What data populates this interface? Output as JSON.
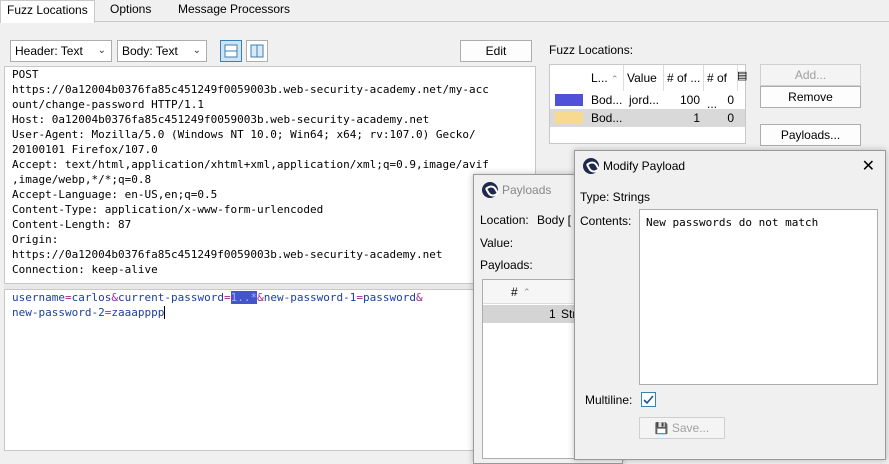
{
  "tabs": [
    "Fuzz Locations",
    "Options",
    "Message Processors"
  ],
  "toolbar": {
    "header_view": "Header: Text",
    "body_view": "Body: Text",
    "edit_label": "Edit"
  },
  "request_header_lines": [
    "POST",
    "https://0a12004b0376fa85c451249f0059003b.web-security-academy.net/my-acc",
    "ount/change-password HTTP/1.1",
    "Host: 0a12004b0376fa85c451249f0059003b.web-security-academy.net",
    "User-Agent: Mozilla/5.0 (Windows NT 10.0; Win64; x64; rv:107.0) Gecko/",
    "20100101 Firefox/107.0",
    "Accept: text/html,application/xhtml+xml,application/xml;q=0.9,image/avif",
    ",image/webp,*/*;q=0.8",
    "Accept-Language: en-US,en;q=0.5",
    "Content-Type: application/x-www-form-urlencoded",
    "Content-Length: 87",
    "Origin:",
    "https://0a12004b0376fa85c451249f0059003b.web-security-academy.net",
    "Connection: keep-alive"
  ],
  "request_body": {
    "k1": "username",
    "v1": "carlos",
    "amp1": "&",
    "k2": "current-password",
    "v2": "1..*",
    "amp2": "&",
    "k3": "new-password-1",
    "v3": "password",
    "amp3": "&",
    "k4": "new-password-2",
    "v4": "zaaapppp",
    "eq": "="
  },
  "fuzz_locations": {
    "label": "Fuzz Locations:",
    "columns": [
      "L...",
      "Value",
      "# of ...",
      "# of ..."
    ],
    "rows": [
      {
        "color": "#5050d8",
        "location": "Bod...",
        "value": "jord...",
        "count1": "100",
        "count2": "0"
      },
      {
        "color": "#f7d98f",
        "location": "Bod...",
        "value": "",
        "count1": "1",
        "count2": "0"
      }
    ],
    "add_label": "Add...",
    "remove_label": "Remove",
    "payloads_label": "Payloads..."
  },
  "payloads_dialog": {
    "title": "Payloads",
    "location_label": "Location:",
    "location_value": "Body [",
    "value_label": "Value:",
    "payloads_label": "Payloads:",
    "col_hash": "#",
    "row_index": "1",
    "row_value": "Str"
  },
  "modify_payload_dialog": {
    "title": "Modify Payload",
    "type_text": "Type:  Strings",
    "contents_label": "Contents:",
    "contents_value": "New passwords do not match",
    "multiline_label": "Multiline:",
    "multiline_checked": true,
    "save_label": "Save..."
  }
}
